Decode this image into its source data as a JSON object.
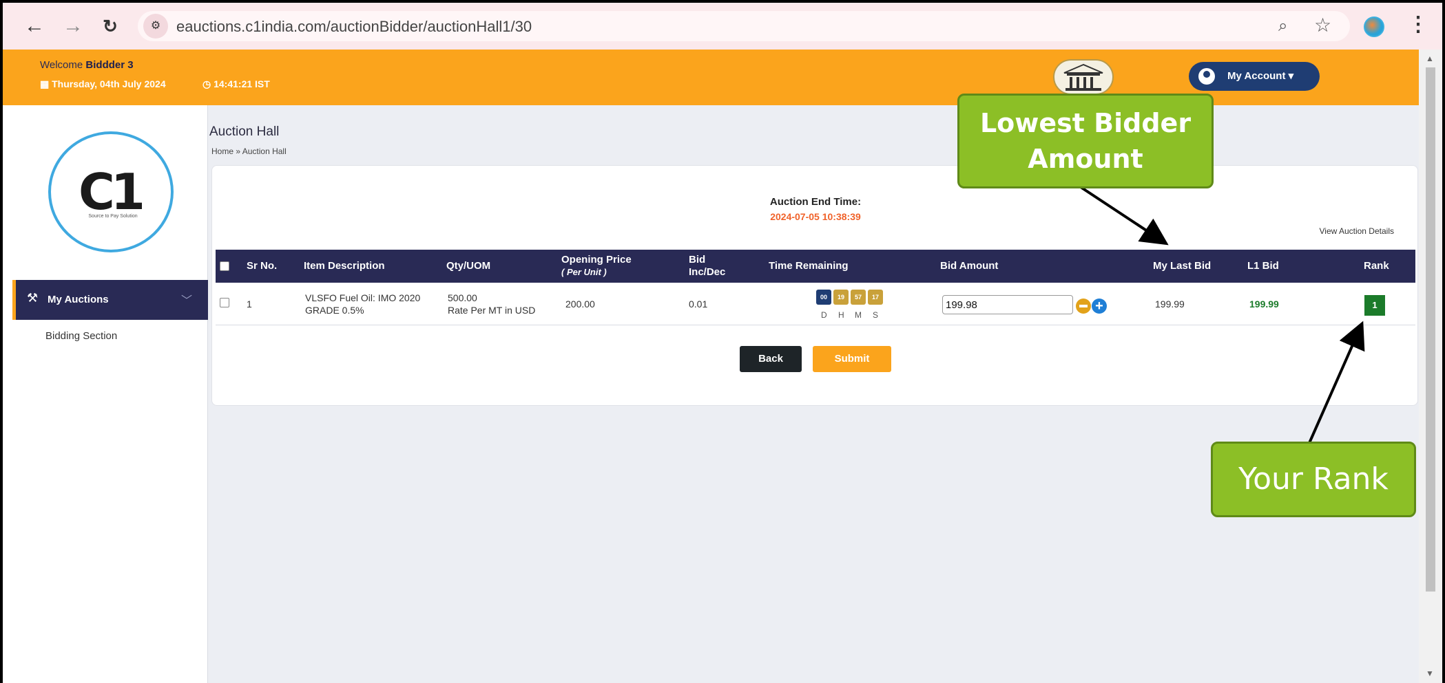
{
  "browser": {
    "url": "eauctions.c1india.com/auctionBidder/auctionHall1/30"
  },
  "header": {
    "welcome_prefix": "Welcome",
    "user_name": "Biddder 3",
    "date": "Thursday, 04th July 2024",
    "time": "14:41:21 IST",
    "account_label": "My Account"
  },
  "sidebar": {
    "logo_text": "C1",
    "logo_tagline": "Source to Pay Solution",
    "menu_label": "My Auctions",
    "submenu_label": "Bidding Section"
  },
  "page": {
    "title": "Auction Hall",
    "breadcrumb_home": "Home",
    "breadcrumb_current": "Auction Hall",
    "end_time_label": "Auction End Time:",
    "end_time_value": "2024-07-05 10:38:39",
    "view_details": "View Auction Details"
  },
  "table": {
    "headers": {
      "sr_no": "Sr No.",
      "item_description": "Item Description",
      "qty_uom": "Qty/UOM",
      "opening_price": "Opening Price",
      "opening_price_sub": "( Per Unit )",
      "bid_inc": "Bid",
      "bid_inc_sub": "Inc/Dec",
      "time_remaining": "Time Remaining",
      "bid_amount": "Bid Amount",
      "my_last_bid": "My Last Bid",
      "l1_bid": "L1 Bid",
      "rank": "Rank"
    },
    "row": {
      "sr_no": "1",
      "item_line1": "VLSFO Fuel Oil: IMO 2020",
      "item_line2": "GRADE 0.5%",
      "qty": "500.00",
      "uom": "Rate Per MT in USD",
      "opening_price": "200.00",
      "bid_inc": "0.01",
      "timer": {
        "d": "00",
        "h": "19",
        "m": "57",
        "s": "17"
      },
      "timer_labels": {
        "d": "D",
        "h": "H",
        "m": "M",
        "s": "S"
      },
      "bid_amount": "199.98",
      "my_last_bid": "199.99",
      "l1_bid": "199.99",
      "rank": "1"
    }
  },
  "buttons": {
    "back": "Back",
    "submit": "Submit"
  },
  "callouts": {
    "lowest_line1": "Lowest Bidder",
    "lowest_line2": "Amount",
    "rank": "Your Rank"
  },
  "colors": {
    "header_orange": "#fba41c",
    "navy": "#292a55",
    "end_time": "#f0622a",
    "rank_green": "#1b7b2a",
    "l1_green": "#1b7b2a",
    "callout_green": "#8cbf26"
  },
  "icons": [
    "back-arrow-icon",
    "forward-arrow-icon",
    "reload-icon",
    "site-info-icon",
    "zoom-icon",
    "star-icon",
    "profile-icon",
    "kebab-menu-icon",
    "calendar-icon",
    "clock-icon",
    "temple-logo-icon",
    "user-icon",
    "caret-down-icon",
    "gavel-icon",
    "chevron-down-icon",
    "minus-icon",
    "plus-icon"
  ]
}
